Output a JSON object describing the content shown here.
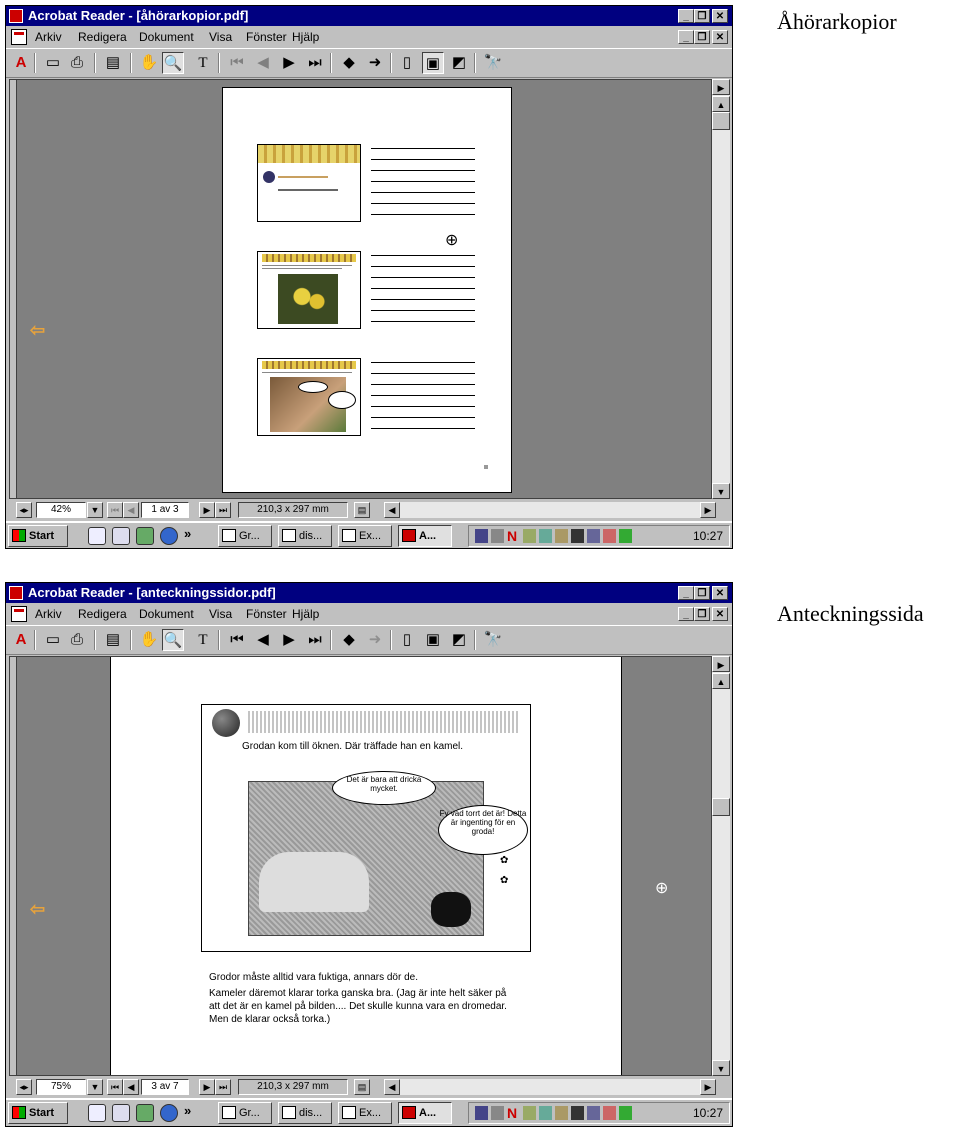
{
  "labels": {
    "first": "Åhörarkopior",
    "second": "Anteckningssida"
  },
  "window1": {
    "title": "Acrobat Reader - [åhörarkopior.pdf]",
    "menu": [
      "Arkiv",
      "Redigera",
      "Dokument",
      "Visa",
      "Fönster",
      "Hjälp"
    ],
    "zoom": "42%",
    "page": "1 av 3",
    "page_size": "210,3 x 297 mm"
  },
  "window2": {
    "title": "Acrobat Reader - [anteckningssidor.pdf]",
    "menu": [
      "Arkiv",
      "Redigera",
      "Dokument",
      "Visa",
      "Fönster",
      "Hjälp"
    ],
    "zoom": "75%",
    "page": "3 av 7",
    "page_size": "210,3 x 297 mm",
    "slide_caption": "Grodan kom till öknen. Där träffade han en kamel.",
    "bubble1": "Det är bara att dricka mycket.",
    "bubble2": "Fy vad torrt det är! Detta är ingenting för en groda!",
    "notes": [
      "Grodor måste alltid vara fuktiga, annars dör de.",
      "Kameler däremot klarar torka ganska bra. (Jag är inte helt säker på",
      "att det är en kamel på bilden.... Det skulle kunna vara en dromedar.",
      "Men de klarar också torka.)"
    ]
  },
  "taskbar": {
    "start": "Start",
    "quick_more": "»",
    "tasks": [
      "Gr...",
      "dis...",
      "Ex...",
      "A..."
    ],
    "tray_n": "N",
    "clock": "10:27"
  },
  "colors": {
    "titlebar": "#000080",
    "face": "#c0c0c0",
    "workspace": "#808080",
    "nav_arrow": "#e6a23c"
  }
}
